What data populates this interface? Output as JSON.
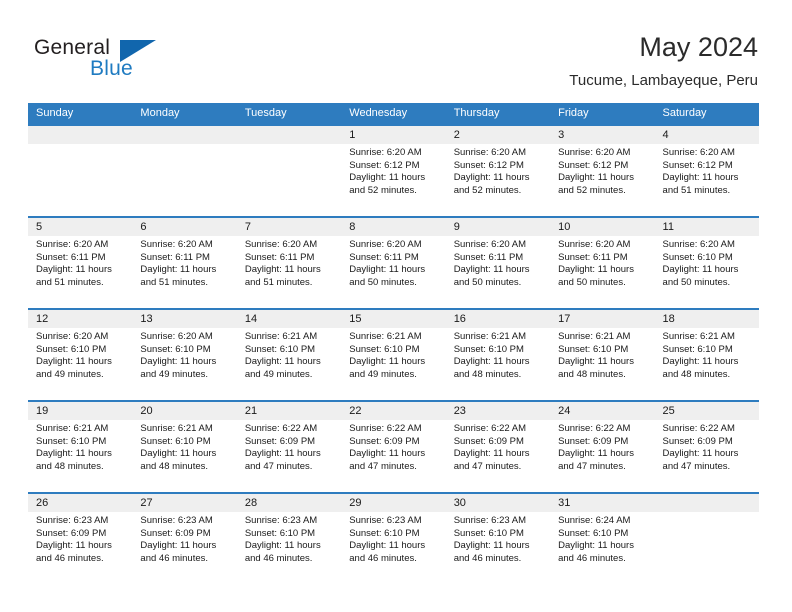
{
  "brand": {
    "name_top": "General",
    "name_bottom": "Blue",
    "triangle_color": "#1166ad",
    "blue_color": "#1f7bc1"
  },
  "header": {
    "title": "May 2024",
    "subtitle": "Tucume, Lambayeque, Peru"
  },
  "theme": {
    "header_blue": "#2e7cbf",
    "daynum_band": "#efefef",
    "text": "#1a1a1a"
  },
  "weekdays": [
    "Sunday",
    "Monday",
    "Tuesday",
    "Wednesday",
    "Thursday",
    "Friday",
    "Saturday"
  ],
  "weeks": [
    [
      {
        "day": "",
        "sunrise": "",
        "sunset": "",
        "daylight1": "",
        "daylight2": ""
      },
      {
        "day": "",
        "sunrise": "",
        "sunset": "",
        "daylight1": "",
        "daylight2": ""
      },
      {
        "day": "",
        "sunrise": "",
        "sunset": "",
        "daylight1": "",
        "daylight2": ""
      },
      {
        "day": "1",
        "sunrise": "Sunrise: 6:20 AM",
        "sunset": "Sunset: 6:12 PM",
        "daylight1": "Daylight: 11 hours",
        "daylight2": "and 52 minutes."
      },
      {
        "day": "2",
        "sunrise": "Sunrise: 6:20 AM",
        "sunset": "Sunset: 6:12 PM",
        "daylight1": "Daylight: 11 hours",
        "daylight2": "and 52 minutes."
      },
      {
        "day": "3",
        "sunrise": "Sunrise: 6:20 AM",
        "sunset": "Sunset: 6:12 PM",
        "daylight1": "Daylight: 11 hours",
        "daylight2": "and 52 minutes."
      },
      {
        "day": "4",
        "sunrise": "Sunrise: 6:20 AM",
        "sunset": "Sunset: 6:12 PM",
        "daylight1": "Daylight: 11 hours",
        "daylight2": "and 51 minutes."
      }
    ],
    [
      {
        "day": "5",
        "sunrise": "Sunrise: 6:20 AM",
        "sunset": "Sunset: 6:11 PM",
        "daylight1": "Daylight: 11 hours",
        "daylight2": "and 51 minutes."
      },
      {
        "day": "6",
        "sunrise": "Sunrise: 6:20 AM",
        "sunset": "Sunset: 6:11 PM",
        "daylight1": "Daylight: 11 hours",
        "daylight2": "and 51 minutes."
      },
      {
        "day": "7",
        "sunrise": "Sunrise: 6:20 AM",
        "sunset": "Sunset: 6:11 PM",
        "daylight1": "Daylight: 11 hours",
        "daylight2": "and 51 minutes."
      },
      {
        "day": "8",
        "sunrise": "Sunrise: 6:20 AM",
        "sunset": "Sunset: 6:11 PM",
        "daylight1": "Daylight: 11 hours",
        "daylight2": "and 50 minutes."
      },
      {
        "day": "9",
        "sunrise": "Sunrise: 6:20 AM",
        "sunset": "Sunset: 6:11 PM",
        "daylight1": "Daylight: 11 hours",
        "daylight2": "and 50 minutes."
      },
      {
        "day": "10",
        "sunrise": "Sunrise: 6:20 AM",
        "sunset": "Sunset: 6:11 PM",
        "daylight1": "Daylight: 11 hours",
        "daylight2": "and 50 minutes."
      },
      {
        "day": "11",
        "sunrise": "Sunrise: 6:20 AM",
        "sunset": "Sunset: 6:10 PM",
        "daylight1": "Daylight: 11 hours",
        "daylight2": "and 50 minutes."
      }
    ],
    [
      {
        "day": "12",
        "sunrise": "Sunrise: 6:20 AM",
        "sunset": "Sunset: 6:10 PM",
        "daylight1": "Daylight: 11 hours",
        "daylight2": "and 49 minutes."
      },
      {
        "day": "13",
        "sunrise": "Sunrise: 6:20 AM",
        "sunset": "Sunset: 6:10 PM",
        "daylight1": "Daylight: 11 hours",
        "daylight2": "and 49 minutes."
      },
      {
        "day": "14",
        "sunrise": "Sunrise: 6:21 AM",
        "sunset": "Sunset: 6:10 PM",
        "daylight1": "Daylight: 11 hours",
        "daylight2": "and 49 minutes."
      },
      {
        "day": "15",
        "sunrise": "Sunrise: 6:21 AM",
        "sunset": "Sunset: 6:10 PM",
        "daylight1": "Daylight: 11 hours",
        "daylight2": "and 49 minutes."
      },
      {
        "day": "16",
        "sunrise": "Sunrise: 6:21 AM",
        "sunset": "Sunset: 6:10 PM",
        "daylight1": "Daylight: 11 hours",
        "daylight2": "and 48 minutes."
      },
      {
        "day": "17",
        "sunrise": "Sunrise: 6:21 AM",
        "sunset": "Sunset: 6:10 PM",
        "daylight1": "Daylight: 11 hours",
        "daylight2": "and 48 minutes."
      },
      {
        "day": "18",
        "sunrise": "Sunrise: 6:21 AM",
        "sunset": "Sunset: 6:10 PM",
        "daylight1": "Daylight: 11 hours",
        "daylight2": "and 48 minutes."
      }
    ],
    [
      {
        "day": "19",
        "sunrise": "Sunrise: 6:21 AM",
        "sunset": "Sunset: 6:10 PM",
        "daylight1": "Daylight: 11 hours",
        "daylight2": "and 48 minutes."
      },
      {
        "day": "20",
        "sunrise": "Sunrise: 6:21 AM",
        "sunset": "Sunset: 6:10 PM",
        "daylight1": "Daylight: 11 hours",
        "daylight2": "and 48 minutes."
      },
      {
        "day": "21",
        "sunrise": "Sunrise: 6:22 AM",
        "sunset": "Sunset: 6:09 PM",
        "daylight1": "Daylight: 11 hours",
        "daylight2": "and 47 minutes."
      },
      {
        "day": "22",
        "sunrise": "Sunrise: 6:22 AM",
        "sunset": "Sunset: 6:09 PM",
        "daylight1": "Daylight: 11 hours",
        "daylight2": "and 47 minutes."
      },
      {
        "day": "23",
        "sunrise": "Sunrise: 6:22 AM",
        "sunset": "Sunset: 6:09 PM",
        "daylight1": "Daylight: 11 hours",
        "daylight2": "and 47 minutes."
      },
      {
        "day": "24",
        "sunrise": "Sunrise: 6:22 AM",
        "sunset": "Sunset: 6:09 PM",
        "daylight1": "Daylight: 11 hours",
        "daylight2": "and 47 minutes."
      },
      {
        "day": "25",
        "sunrise": "Sunrise: 6:22 AM",
        "sunset": "Sunset: 6:09 PM",
        "daylight1": "Daylight: 11 hours",
        "daylight2": "and 47 minutes."
      }
    ],
    [
      {
        "day": "26",
        "sunrise": "Sunrise: 6:23 AM",
        "sunset": "Sunset: 6:09 PM",
        "daylight1": "Daylight: 11 hours",
        "daylight2": "and 46 minutes."
      },
      {
        "day": "27",
        "sunrise": "Sunrise: 6:23 AM",
        "sunset": "Sunset: 6:09 PM",
        "daylight1": "Daylight: 11 hours",
        "daylight2": "and 46 minutes."
      },
      {
        "day": "28",
        "sunrise": "Sunrise: 6:23 AM",
        "sunset": "Sunset: 6:10 PM",
        "daylight1": "Daylight: 11 hours",
        "daylight2": "and 46 minutes."
      },
      {
        "day": "29",
        "sunrise": "Sunrise: 6:23 AM",
        "sunset": "Sunset: 6:10 PM",
        "daylight1": "Daylight: 11 hours",
        "daylight2": "and 46 minutes."
      },
      {
        "day": "30",
        "sunrise": "Sunrise: 6:23 AM",
        "sunset": "Sunset: 6:10 PM",
        "daylight1": "Daylight: 11 hours",
        "daylight2": "and 46 minutes."
      },
      {
        "day": "31",
        "sunrise": "Sunrise: 6:24 AM",
        "sunset": "Sunset: 6:10 PM",
        "daylight1": "Daylight: 11 hours",
        "daylight2": "and 46 minutes."
      },
      {
        "day": "",
        "sunrise": "",
        "sunset": "",
        "daylight1": "",
        "daylight2": ""
      }
    ]
  ]
}
